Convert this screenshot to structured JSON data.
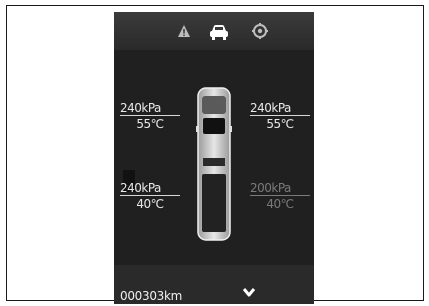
{
  "header_icons": [
    "warning-icon",
    "car-icon",
    "settings-icon"
  ],
  "tires": {
    "front_left": {
      "pressure": "240kPa",
      "temperature": "55℃"
    },
    "front_right": {
      "pressure": "240kPa",
      "temperature": "55℃"
    },
    "rear_left": {
      "pressure": "240kPa",
      "temperature": "40℃"
    },
    "rear_right": {
      "pressure": "200kPa",
      "temperature": "40℃"
    }
  },
  "footer": {
    "odometer": "000303km",
    "chevron": "chevron-down-icon"
  },
  "colors": {
    "screen_bg": "#222222",
    "text": "#e8e8e8",
    "dim_text": "#7a7a7a"
  }
}
